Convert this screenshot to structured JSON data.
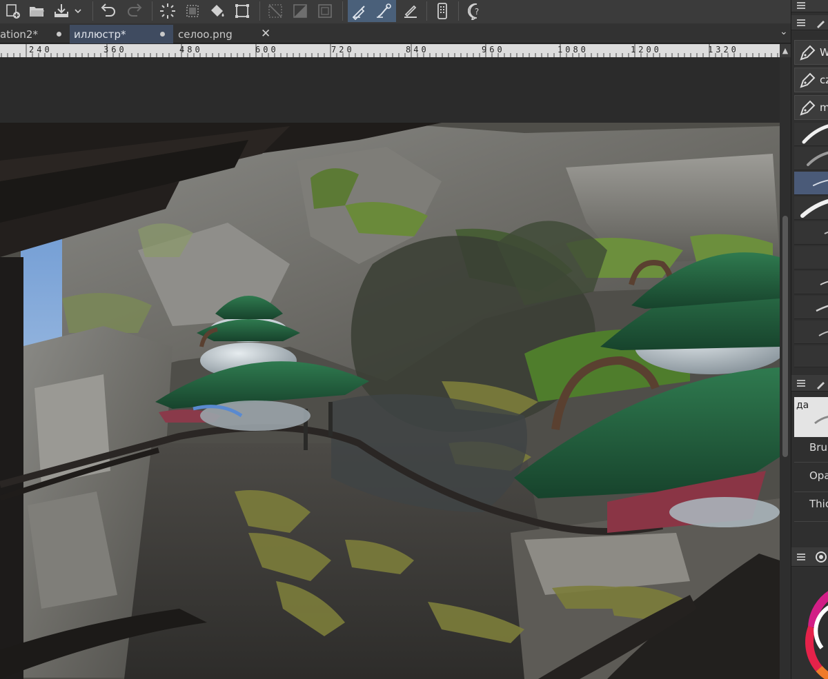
{
  "toolbar": {
    "buttons": [
      {
        "name": "new-document-icon"
      },
      {
        "name": "open-folder-icon"
      },
      {
        "name": "save-icon"
      },
      {
        "name": "undo-icon"
      },
      {
        "name": "redo-icon"
      },
      {
        "name": "lasso-select-icon"
      },
      {
        "name": "select-rect-icon"
      },
      {
        "name": "fill-bucket-icon"
      },
      {
        "name": "transform-icon"
      },
      {
        "name": "deselect-icon"
      },
      {
        "name": "invert-select-icon"
      },
      {
        "name": "crop-icon"
      },
      {
        "name": "pen-stabilizer-icon",
        "active": true
      },
      {
        "name": "brush-stabilizer-icon",
        "active": true
      },
      {
        "name": "ruler-pen-icon"
      },
      {
        "name": "tablet-icon"
      },
      {
        "name": "help-icon"
      }
    ]
  },
  "tabs": [
    {
      "label": "ation2*",
      "modified": true
    },
    {
      "label": "иллюстр*",
      "modified": true,
      "active": true
    },
    {
      "label": "селоо.png",
      "close": "✕"
    }
  ],
  "ruler": {
    "labels": [
      "240",
      "360",
      "480",
      "600",
      "720",
      "840",
      "960",
      "1080",
      "1200",
      "1320"
    ]
  },
  "dock": {
    "brush_presets": [
      {
        "label": "W"
      },
      {
        "label": "cz"
      },
      {
        "label": "m"
      }
    ],
    "thumb_label": "да",
    "properties": [
      "Bru",
      "Opa",
      "Thic"
    ]
  },
  "colors": {
    "accent": "#4a607a",
    "tab_active": "#3f4b60",
    "panel": "#2f2f2f"
  }
}
